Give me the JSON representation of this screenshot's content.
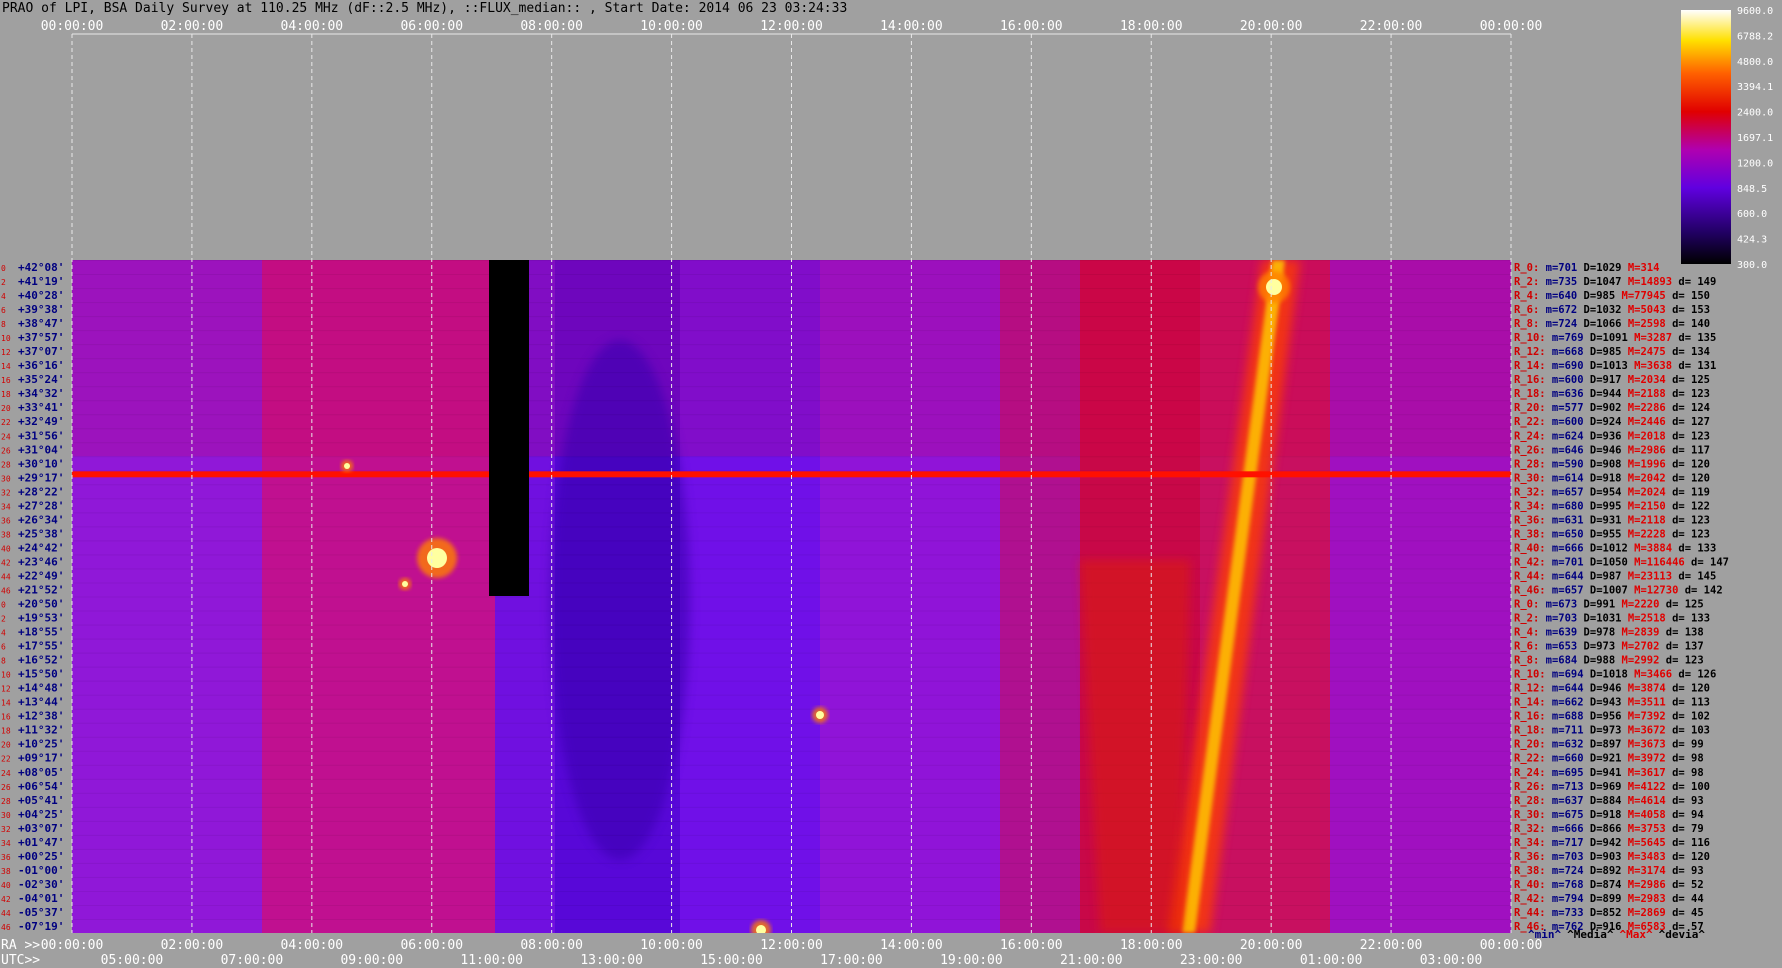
{
  "title": "PRAO of LPI, BSA Daily Survey at 110.25 MHz (dF::2.5 MHz), ::FLUX_median:: , Start Date: 2014 06 23 03:24:33",
  "colors": {
    "bg": "#a0a0a0",
    "grid": "#e8e8e8",
    "tick_red": "#d00000",
    "tick_blue": "#000080",
    "gap": "#000000"
  },
  "chart_data": {
    "type": "heatmap",
    "title": "PRAO of LPI, BSA Daily Survey at 110.25 MHz (dF::2.5 MHz), ::FLUX_median:: , Start Date: 2014 06 23 03:24:33",
    "top_axis_ticks": [
      "00:00:00",
      "02:00:00",
      "04:00:00",
      "06:00:00",
      "08:00:00",
      "10:00:00",
      "12:00:00",
      "14:00:00",
      "16:00:00",
      "18:00:00",
      "20:00:00",
      "22:00:00",
      "00:00:00"
    ],
    "ra_axis_label": "RA >>",
    "ra_axis_ticks": [
      "00:00:00",
      "02:00:00",
      "04:00:00",
      "06:00:00",
      "08:00:00",
      "10:00:00",
      "12:00:00",
      "14:00:00",
      "16:00:00",
      "18:00:00",
      "20:00:00",
      "22:00:00",
      "00:00:00"
    ],
    "utc_axis_label": "UTC>>",
    "utc_axis_ticks": [
      "05:00:00",
      "07:00:00",
      "09:00:00",
      "11:00:00",
      "13:00:00",
      "15:00:00",
      "17:00:00",
      "19:00:00",
      "21:00:00",
      "23:00:00",
      "01:00:00",
      "03:00:00"
    ],
    "declinations": [
      "+42°08'",
      "+41°19'",
      "+40°28'",
      "+39°38'",
      "+38°47'",
      "+37°57'",
      "+37°07'",
      "+36°16'",
      "+35°24'",
      "+34°32'",
      "+33°41'",
      "+32°49'",
      "+31°56'",
      "+31°04'",
      "+30°10'",
      "+29°17'",
      "+28°22'",
      "+27°28'",
      "+26°34'",
      "+25°38'",
      "+24°42'",
      "+23°46'",
      "+22°49'",
      "+21°52'",
      "+20°50'",
      "+19°53'",
      "+18°55'",
      "+17°55'",
      "+16°52'",
      "+15°50'",
      "+14°48'",
      "+13°44'",
      "+12°38'",
      "+11°32'",
      "+10°25'",
      "+09°17'",
      "+08°05'",
      "+06°54'",
      "+05°41'",
      "+04°25'",
      "+03°07'",
      "+01°47'",
      "+00°25'",
      "-01°00'",
      "-02°30'",
      "-04°01'",
      "-05°37'",
      "-07°19'"
    ],
    "beam_numbers": [
      "0",
      "2",
      "4",
      "6",
      "8",
      "10",
      "12",
      "14",
      "16",
      "18",
      "20",
      "22",
      "24",
      "26",
      "28",
      "30",
      "32",
      "34",
      "36",
      "38",
      "40",
      "42",
      "44",
      "46",
      "0",
      "2",
      "4",
      "6",
      "8",
      "10",
      "12",
      "14",
      "16",
      "18",
      "20",
      "22",
      "24",
      "26",
      "28",
      "30",
      "32",
      "34",
      "36",
      "38",
      "40",
      "42",
      "44",
      "46"
    ],
    "colorbar": {
      "ticks": [
        "9600.0",
        "6788.2",
        "4800.0",
        "3394.1",
        "2400.0",
        "1697.1",
        "1200.0",
        "848.5",
        "600.0",
        "424.3",
        "300.0"
      ],
      "scale": "log",
      "min": 300,
      "max": 9600
    },
    "stats_headers": [
      "^min^",
      "^Media^",
      "^Max^",
      "^devia^"
    ],
    "stats": [
      {
        "beam": "R_0:",
        "min": "m=701",
        "median": "D=1029",
        "max": "M=314",
        "dev": ""
      },
      {
        "beam": "R_2:",
        "min": "m=735",
        "median": "D=1047",
        "max": "M=14893",
        "dev": "d= 149"
      },
      {
        "beam": "R_4:",
        "min": "m=640",
        "median": "D=985",
        "max": "M=77945",
        "dev": "d= 150"
      },
      {
        "beam": "R_6:",
        "min": "m=672",
        "median": "D=1032",
        "max": "M=5043",
        "dev": "d= 153"
      },
      {
        "beam": "R_8:",
        "min": "m=724",
        "median": "D=1066",
        "max": "M=2598",
        "dev": "d= 140"
      },
      {
        "beam": "R_10:",
        "min": "m=769",
        "median": "D=1091",
        "max": "M=3287",
        "dev": "d= 135"
      },
      {
        "beam": "R_12:",
        "min": "m=668",
        "median": "D=985",
        "max": "M=2475",
        "dev": "d= 134"
      },
      {
        "beam": "R_14:",
        "min": "m=690",
        "median": "D=1013",
        "max": "M=3638",
        "dev": "d= 131"
      },
      {
        "beam": "R_16:",
        "min": "m=600",
        "median": "D=917",
        "max": "M=2034",
        "dev": "d= 125"
      },
      {
        "beam": "R_18:",
        "min": "m=636",
        "median": "D=944",
        "max": "M=2188",
        "dev": "d= 123"
      },
      {
        "beam": "R_20:",
        "min": "m=577",
        "median": "D=902",
        "max": "M=2286",
        "dev": "d= 124"
      },
      {
        "beam": "R_22:",
        "min": "m=600",
        "median": "D=924",
        "max": "M=2446",
        "dev": "d= 127"
      },
      {
        "beam": "R_24:",
        "min": "m=624",
        "median": "D=936",
        "max": "M=2018",
        "dev": "d= 123"
      },
      {
        "beam": "R_26:",
        "min": "m=646",
        "median": "D=946",
        "max": "M=2986",
        "dev": "d= 117"
      },
      {
        "beam": "R_28:",
        "min": "m=590",
        "median": "D=908",
        "max": "M=1996",
        "dev": "d= 120"
      },
      {
        "beam": "R_30:",
        "min": "m=614",
        "median": "D=918",
        "max": "M=2042",
        "dev": "d= 120"
      },
      {
        "beam": "R_32:",
        "min": "m=657",
        "median": "D=954",
        "max": "M=2024",
        "dev": "d= 119"
      },
      {
        "beam": "R_34:",
        "min": "m=680",
        "median": "D=995",
        "max": "M=2150",
        "dev": "d= 122"
      },
      {
        "beam": "R_36:",
        "min": "m=631",
        "median": "D=931",
        "max": "M=2118",
        "dev": "d= 123"
      },
      {
        "beam": "R_38:",
        "min": "m=650",
        "median": "D=955",
        "max": "M=2228",
        "dev": "d= 123"
      },
      {
        "beam": "R_40:",
        "min": "m=666",
        "median": "D=1012",
        "max": "M=3884",
        "dev": "d= 133"
      },
      {
        "beam": "R_42:",
        "min": "m=701",
        "median": "D=1050",
        "max": "M=116446",
        "dev": "d= 147"
      },
      {
        "beam": "R_44:",
        "min": "m=644",
        "median": "D=987",
        "max": "M=23113",
        "dev": "d= 145"
      },
      {
        "beam": "R_46:",
        "min": "m=657",
        "median": "D=1007",
        "max": "M=12730",
        "dev": "d= 142"
      },
      {
        "beam": "R_0:",
        "min": "m=673",
        "median": "D=991",
        "max": "M=2220",
        "dev": "d= 125"
      },
      {
        "beam": "R_2:",
        "min": "m=703",
        "median": "D=1031",
        "max": "M=2518",
        "dev": "d= 133"
      },
      {
        "beam": "R_4:",
        "min": "m=639",
        "median": "D=978",
        "max": "M=2839",
        "dev": "d= 138"
      },
      {
        "beam": "R_6:",
        "min": "m=653",
        "median": "D=973",
        "max": "M=2702",
        "dev": "d= 137"
      },
      {
        "beam": "R_8:",
        "min": "m=684",
        "median": "D=988",
        "max": "M=2992",
        "dev": "d= 123"
      },
      {
        "beam": "R_10:",
        "min": "m=694",
        "median": "D=1018",
        "max": "M=3466",
        "dev": "d= 126"
      },
      {
        "beam": "R_12:",
        "min": "m=644",
        "median": "D=946",
        "max": "M=3874",
        "dev": "d= 120"
      },
      {
        "beam": "R_14:",
        "min": "m=662",
        "median": "D=943",
        "max": "M=3511",
        "dev": "d= 113"
      },
      {
        "beam": "R_16:",
        "min": "m=688",
        "median": "D=956",
        "max": "M=7392",
        "dev": "d= 102"
      },
      {
        "beam": "R_18:",
        "min": "m=711",
        "median": "D=973",
        "max": "M=3672",
        "dev": "d= 103"
      },
      {
        "beam": "R_20:",
        "min": "m=632",
        "median": "D=897",
        "max": "M=3673",
        "dev": "d= 99"
      },
      {
        "beam": "R_22:",
        "min": "m=660",
        "median": "D=921",
        "max": "M=3972",
        "dev": "d= 98"
      },
      {
        "beam": "R_24:",
        "min": "m=695",
        "median": "D=941",
        "max": "M=3617",
        "dev": "d= 98"
      },
      {
        "beam": "R_26:",
        "min": "m=713",
        "median": "D=969",
        "max": "M=4122",
        "dev": "d= 100"
      },
      {
        "beam": "R_28:",
        "min": "m=637",
        "median": "D=884",
        "max": "M=4614",
        "dev": "d= 93"
      },
      {
        "beam": "R_30:",
        "min": "m=675",
        "median": "D=918",
        "max": "M=4058",
        "dev": "d= 94"
      },
      {
        "beam": "R_32:",
        "min": "m=666",
        "median": "D=866",
        "max": "M=3753",
        "dev": "d= 79"
      },
      {
        "beam": "R_34:",
        "min": "m=717",
        "median": "D=942",
        "max": "M=5645",
        "dev": "d= 116"
      },
      {
        "beam": "R_36:",
        "min": "m=703",
        "median": "D=903",
        "max": "M=3483",
        "dev": "d= 120"
      },
      {
        "beam": "R_38:",
        "min": "m=724",
        "median": "D=892",
        "max": "M=3174",
        "dev": "d= 93"
      },
      {
        "beam": "R_40:",
        "min": "m=768",
        "median": "D=874",
        "max": "M=2986",
        "dev": "d= 52"
      },
      {
        "beam": "R_42:",
        "min": "m=794",
        "median": "D=899",
        "max": "M=2983",
        "dev": "d= 44"
      },
      {
        "beam": "R_44:",
        "min": "m=733",
        "median": "D=852",
        "max": "M=2869",
        "dev": "d= 45"
      },
      {
        "beam": "R_46:",
        "min": "m=762",
        "median": "D=916",
        "max": "M=6583",
        "dev": "d= 57"
      }
    ]
  }
}
